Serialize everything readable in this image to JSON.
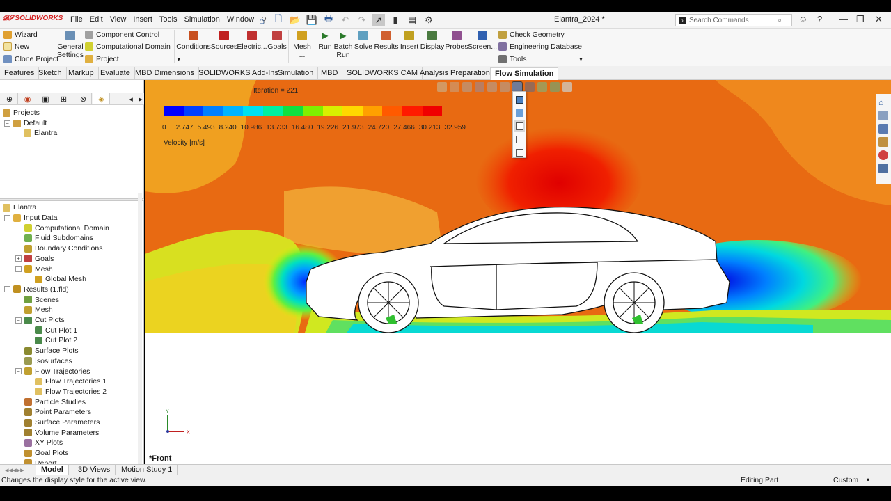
{
  "app": {
    "logo_text": "SOLIDWORKS",
    "document_title": "Elantra_2024 *",
    "menu": [
      "File",
      "Edit",
      "View",
      "Insert",
      "Tools",
      "Simulation",
      "Window"
    ],
    "search_placeholder": "Search Commands"
  },
  "ribbon": {
    "left_group": [
      "Wizard",
      "New",
      "Clone Project"
    ],
    "general_settings": "General Settings",
    "component_group": [
      "Component Control",
      "Computational Domain",
      "Project"
    ],
    "big_buttons": [
      "Conditions",
      "Sources",
      "Electric...",
      "Goals",
      "Mesh ...",
      "Run",
      "Batch Run",
      "Solve",
      "Results",
      "Insert",
      "Display",
      "Probes",
      "Screen..."
    ],
    "right_group": [
      "Check Geometry",
      "Engineering Database",
      "Tools"
    ]
  },
  "command_tabs": [
    "Features",
    "Sketch",
    "Markup",
    "Evaluate",
    "MBD Dimensions",
    "SOLIDWORKS Add-Ins",
    "Simulation",
    "MBD",
    "SOLIDWORKS CAM",
    "Analysis Preparation",
    "Flow Simulation"
  ],
  "active_command_tab": "Flow Simulation",
  "projects_tree": {
    "root": "Projects",
    "config": "Default",
    "part": "Elantra"
  },
  "analysis_tree": {
    "root": "Elantra",
    "items": [
      {
        "label": "Input Data",
        "level": 1,
        "expand": "-"
      },
      {
        "label": "Computational Domain",
        "level": 2
      },
      {
        "label": "Fluid Subdomains",
        "level": 2
      },
      {
        "label": "Boundary Conditions",
        "level": 2
      },
      {
        "label": "Goals",
        "level": 2,
        "expand": "+"
      },
      {
        "label": "Mesh",
        "level": 2,
        "expand": "-"
      },
      {
        "label": "Global Mesh",
        "level": 3
      },
      {
        "label": "Results (1.fld)",
        "level": 1,
        "expand": "-"
      },
      {
        "label": "Scenes",
        "level": 2
      },
      {
        "label": "Mesh",
        "level": 2
      },
      {
        "label": "Cut Plots",
        "level": 2,
        "expand": "-"
      },
      {
        "label": "Cut Plot 1",
        "level": 3
      },
      {
        "label": "Cut Plot 2",
        "level": 3
      },
      {
        "label": "Surface Plots",
        "level": 2
      },
      {
        "label": "Isosurfaces",
        "level": 2
      },
      {
        "label": "Flow Trajectories",
        "level": 2,
        "expand": "-"
      },
      {
        "label": "Flow Trajectories 1",
        "level": 3
      },
      {
        "label": "Flow Trajectories 2",
        "level": 3
      },
      {
        "label": "Particle Studies",
        "level": 2
      },
      {
        "label": "Point Parameters",
        "level": 2
      },
      {
        "label": "Surface Parameters",
        "level": 2
      },
      {
        "label": "Volume Parameters",
        "level": 2
      },
      {
        "label": "XY Plots",
        "level": 2
      },
      {
        "label": "Goal Plots",
        "level": 2
      },
      {
        "label": "Report",
        "level": 2
      }
    ]
  },
  "viewport": {
    "iteration_text": "Iteration = 221",
    "legend_title": "Velocity [m/s]",
    "legend_ticks": [
      "0",
      "2.747",
      "5.493",
      "8.240",
      "10.986",
      "13.733",
      "16.480",
      "19.226",
      "21.973",
      "24.720",
      "27.466",
      "30.213",
      "32.959"
    ],
    "legend_colors": [
      "#0000ff",
      "#0040ff",
      "#0080ff",
      "#00b4ff",
      "#00e0f0",
      "#00f0a0",
      "#10e040",
      "#80f000",
      "#d8f000",
      "#ffd800",
      "#ffa000",
      "#ff5a00",
      "#ff1a00",
      "#f00000"
    ],
    "view_name": "*Front",
    "axis_y": "Y",
    "axis_x": "X"
  },
  "bottom_tabs": [
    "Model",
    "3D Views",
    "Motion Study 1"
  ],
  "status": {
    "message": "Changes the display style for the active view.",
    "mode": "Editing Part",
    "units": "Custom"
  }
}
